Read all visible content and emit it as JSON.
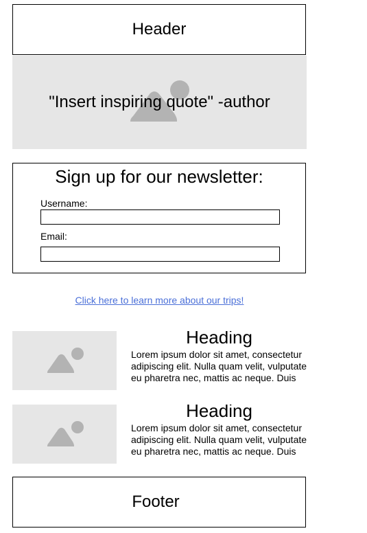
{
  "header": {
    "label": "Header"
  },
  "hero": {
    "quote": "\"Insert inspiring quote\" -author",
    "bg_color": "#e6e6e6",
    "icon": "image-placeholder-icon"
  },
  "newsletter": {
    "title": "Sign up for our newsletter:",
    "username_label": "Username:",
    "username_value": "",
    "email_label": "Email:",
    "email_value": ""
  },
  "link": {
    "text": "Click here to learn more about our trips!",
    "color": "#4a6fd8"
  },
  "cards": [
    {
      "heading": "Heading",
      "body": "Lorem ipsum dolor sit amet, consectetur adipiscing elit. Nulla quam velit, vulputate eu pharetra nec, mattis ac neque. Duis"
    },
    {
      "heading": "Heading",
      "body": "Lorem ipsum dolor sit amet, consectetur adipiscing elit. Nulla quam velit, vulputate eu pharetra nec, mattis ac neque. Duis"
    }
  ],
  "footer": {
    "label": "Footer"
  }
}
